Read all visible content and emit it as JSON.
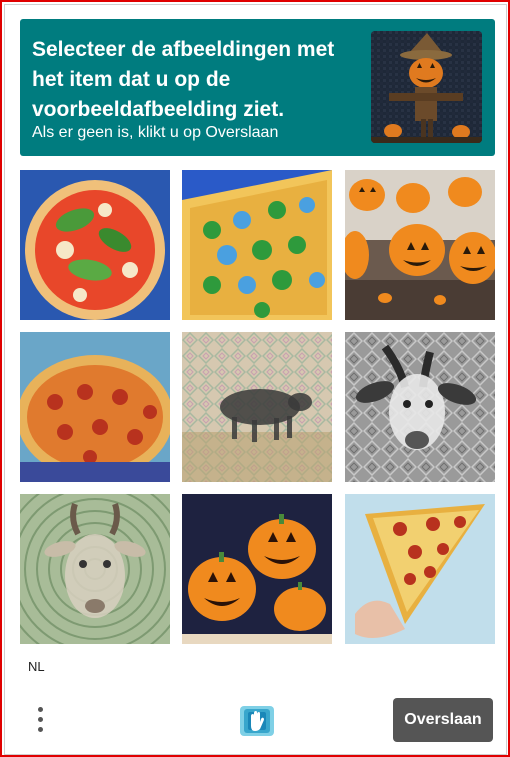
{
  "header": {
    "title": "Selecteer de afbeeldingen met het item dat u op de voorbeeldafbeelding ziet.",
    "subtitle": "Als er geen is, klikt u op Overslaan",
    "example_image": "scarecrow-with-pumpkin-head",
    "background_color": "#007c7f"
  },
  "grid": {
    "tiles": [
      {
        "subject": "pizza-with-basil"
      },
      {
        "subject": "pizza-slice-green-toppings"
      },
      {
        "subject": "jack-o-lanterns"
      },
      {
        "subject": "pizza-pepperoni"
      },
      {
        "subject": "animal-silhouette-noisy"
      },
      {
        "subject": "goat-noisy"
      },
      {
        "subject": "goat-concentric-pattern"
      },
      {
        "subject": "jack-o-lanterns"
      },
      {
        "subject": "pizza-slice-pepperoni"
      }
    ]
  },
  "footer": {
    "language": "NL",
    "skip_label": "Overslaan",
    "logo": "hcaptcha-hand-logo",
    "menu_icon": "kebab-menu-icon"
  }
}
